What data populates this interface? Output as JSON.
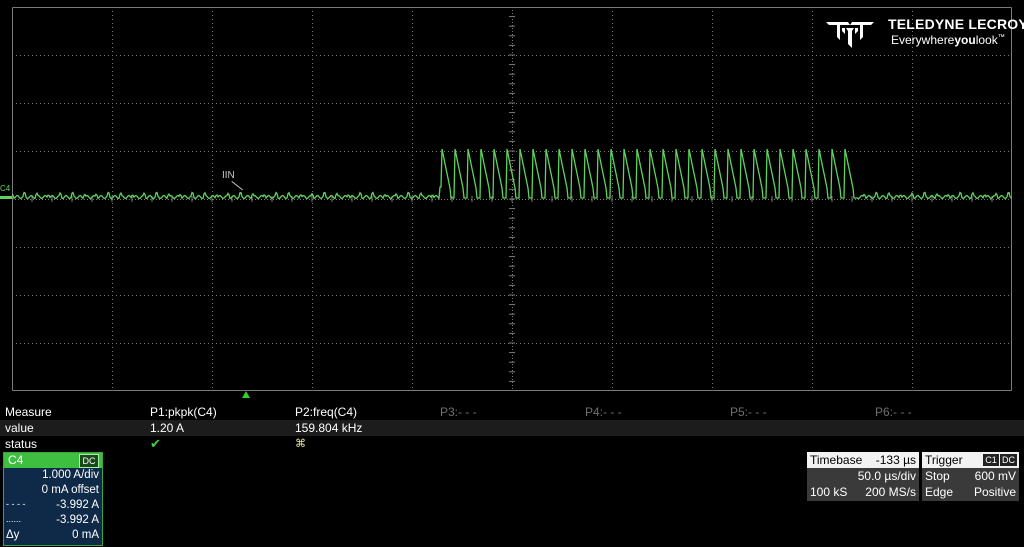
{
  "brand": {
    "name": "TELEDYNE LECROY",
    "tagline": "Everywhereyoulook™",
    "tagline_parts": [
      "Everywhere",
      "you",
      "look",
      "™"
    ]
  },
  "trace": {
    "channel_label": "C4",
    "annotation": "IIN",
    "color": "#5ed35e"
  },
  "measure": {
    "row_labels": [
      "Measure",
      "value",
      "status"
    ],
    "params": [
      {
        "name": "P1:pkpk(C4)",
        "value": "1.20 A",
        "status": "ok"
      },
      {
        "name": "P2:freq(C4)",
        "value": "159.804 kHz",
        "status": "warn"
      },
      {
        "name": "P3:- - -",
        "value": "",
        "status": ""
      },
      {
        "name": "P4:- - -",
        "value": "",
        "status": ""
      },
      {
        "name": "P5:- - -",
        "value": "",
        "status": ""
      },
      {
        "name": "P6:- - -",
        "value": "",
        "status": ""
      }
    ],
    "status_ok_glyph": "✔",
    "status_warn_glyph": "⌘"
  },
  "channel": {
    "name": "C4",
    "coupling": "DC",
    "vdiv": "1.000 A/div",
    "offset": "0 mA offset",
    "cursor1_label": "- - - -",
    "cursor1_value": "-3.992 A",
    "cursor2_label": "......",
    "cursor2_value": "-3.992 A",
    "delta_label": "Δy",
    "delta_value": "0 mA"
  },
  "timebase": {
    "title": "Timebase",
    "delay": "-133 µs",
    "tdiv": "50.0 µs/div",
    "samples": "100 kS",
    "rate": "200 MS/s"
  },
  "trigger": {
    "title": "Trigger",
    "source": "C1",
    "coupling": "DC",
    "mode": "Stop",
    "level": "600 mV",
    "type": "Edge",
    "slope": "Positive"
  },
  "colors": {
    "grid": "#7a7a7a",
    "trace": "#5ed35e",
    "channel_header": "#3fbf3f",
    "channel_panel": "#0e2a48"
  }
}
